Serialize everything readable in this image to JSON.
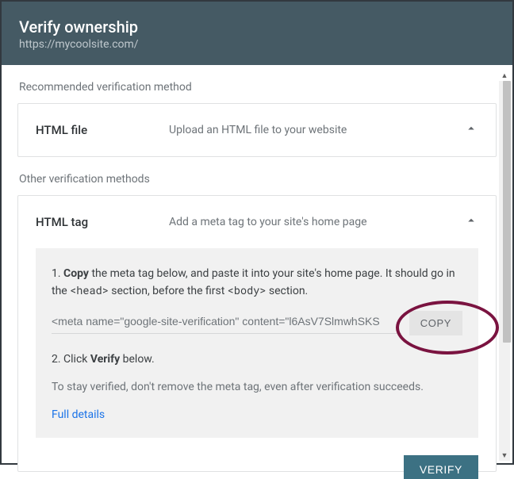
{
  "header": {
    "title": "Verify ownership",
    "site_url": "https://mycoolsite.com/"
  },
  "sections": {
    "recommended_label": "Recommended verification method",
    "other_label": "Other verification methods"
  },
  "html_file_card": {
    "title": "HTML file",
    "desc": "Upload an HTML file to your website"
  },
  "html_tag_card": {
    "title": "HTML tag",
    "desc": "Add a meta tag to your site's home page",
    "step1_prefix": "1. ",
    "step1_copy": "Copy",
    "step1_mid1": " the meta tag below, and paste it into your site's home page. It should go in the ",
    "step1_head": "<head>",
    "step1_mid2": " section, before the first ",
    "step1_body": "<body>",
    "step1_end": " section.",
    "meta_tag": "<meta name=\"google-site-verification\" content=\"l6AsV7SlmwhSKS",
    "copy_button": "COPY",
    "step2_prefix": "2. Click ",
    "step2_verify": "Verify",
    "step2_end": " below.",
    "note": "To stay verified, don't remove the meta tag, even after verification succeeds.",
    "full_details": "Full details"
  },
  "verify_button": "VERIFY"
}
